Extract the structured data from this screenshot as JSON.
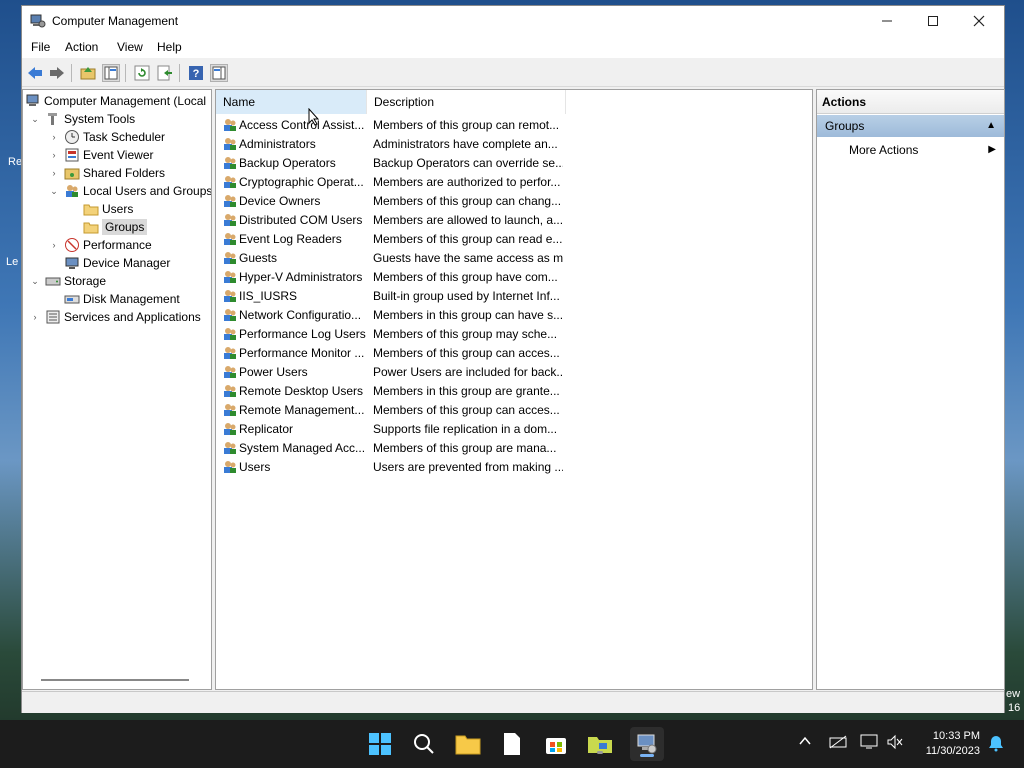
{
  "desktop": {
    "frag1": "Re",
    "frag2": "Le",
    "frag3": "ew",
    "frag4": "16"
  },
  "window": {
    "title": "Computer Management",
    "menu": [
      "File",
      "Action",
      "View",
      "Help"
    ]
  },
  "tree": {
    "root": "Computer Management (Local",
    "system_tools": "System Tools",
    "task_scheduler": "Task Scheduler",
    "event_viewer": "Event Viewer",
    "shared_folders": "Shared Folders",
    "local_users_groups": "Local Users and Groups",
    "users": "Users",
    "groups": "Groups",
    "performance": "Performance",
    "device_manager": "Device Manager",
    "storage": "Storage",
    "disk_management": "Disk Management",
    "services_apps": "Services and Applications"
  },
  "list": {
    "columns": {
      "name": "Name",
      "description": "Description"
    },
    "rows": [
      {
        "name": "Access Control Assist...",
        "description": "Members of this group can remot..."
      },
      {
        "name": "Administrators",
        "description": "Administrators have complete an..."
      },
      {
        "name": "Backup Operators",
        "description": "Backup Operators can override se..."
      },
      {
        "name": "Cryptographic Operat...",
        "description": "Members are authorized to perfor..."
      },
      {
        "name": "Device Owners",
        "description": "Members of this group can chang..."
      },
      {
        "name": "Distributed COM Users",
        "description": "Members are allowed to launch, a..."
      },
      {
        "name": "Event Log Readers",
        "description": "Members of this group can read e..."
      },
      {
        "name": "Guests",
        "description": "Guests have the same access as m..."
      },
      {
        "name": "Hyper-V Administrators",
        "description": "Members of this group have com..."
      },
      {
        "name": "IIS_IUSRS",
        "description": "Built-in group used by Internet Inf..."
      },
      {
        "name": "Network Configuratio...",
        "description": "Members in this group can have s..."
      },
      {
        "name": "Performance Log Users",
        "description": "Members of this group may sche..."
      },
      {
        "name": "Performance Monitor ...",
        "description": "Members of this group can acces..."
      },
      {
        "name": "Power Users",
        "description": "Power Users are included for back..."
      },
      {
        "name": "Remote Desktop Users",
        "description": "Members in this group are grante..."
      },
      {
        "name": "Remote Management...",
        "description": "Members of this group can acces..."
      },
      {
        "name": "Replicator",
        "description": "Supports file replication in a dom..."
      },
      {
        "name": "System Managed Acc...",
        "description": "Members of this group are mana..."
      },
      {
        "name": "Users",
        "description": "Users are prevented from making ..."
      }
    ]
  },
  "actions": {
    "header": "Actions",
    "group": "Groups",
    "more_actions": "More Actions"
  },
  "taskbar": {
    "time": "10:33 PM",
    "date": "11/30/2023"
  },
  "colors": {
    "selection": "#d9ebf9",
    "action_group": "#a9c4e0",
    "taskbar": "#1c1c1c"
  }
}
